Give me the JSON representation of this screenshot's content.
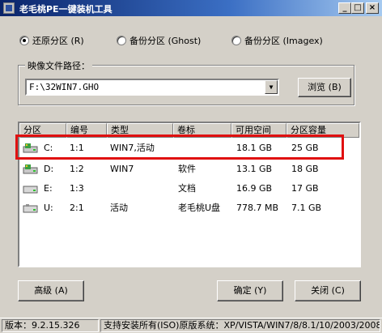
{
  "window": {
    "title": "老毛桃PE一键装机工具",
    "minimize_label": "_",
    "maximize_label": "□",
    "close_label": "×"
  },
  "mode": {
    "options": [
      {
        "label": "还原分区 (R)",
        "checked": true
      },
      {
        "label": "备份分区 (Ghost)",
        "checked": false
      },
      {
        "label": "备份分区 (Imagex)",
        "checked": false
      }
    ]
  },
  "image_path": {
    "group_label": "映像文件路径：",
    "value": "F:\\32WIN7.GHO",
    "browse_label": "浏览 (B)"
  },
  "table": {
    "columns": [
      "分区",
      "编号",
      "类型",
      "卷标",
      "可用空间",
      "分区容量"
    ],
    "rows": [
      {
        "drive": "C:",
        "num": "1:1",
        "type": "WIN7,活动",
        "label": "",
        "free": "18.1 GB",
        "size": "25 GB",
        "icon": "system-disk-icon"
      },
      {
        "drive": "D:",
        "num": "1:2",
        "type": "WIN7",
        "label": "软件",
        "free": "13.1 GB",
        "size": "18 GB",
        "icon": "system-disk-icon"
      },
      {
        "drive": "E:",
        "num": "1:3",
        "type": "",
        "label": "文档",
        "free": "16.9 GB",
        "size": "17 GB",
        "icon": "hard-disk-icon"
      },
      {
        "drive": "U:",
        "num": "2:1",
        "type": "活动",
        "label": "老毛桃U盘",
        "free": "778.7 MB",
        "size": "7.1 GB",
        "icon": "usb-disk-icon"
      }
    ]
  },
  "buttons": {
    "advanced": "高级 (A)",
    "ok": "确定 (Y)",
    "close": "关闭 (C)"
  },
  "status": {
    "version": "版本：9.2.15.326",
    "support": "支持安装所有(ISO)原版系统：XP/VISTA/WIN7/8/8.1/10/2003/2008/"
  }
}
